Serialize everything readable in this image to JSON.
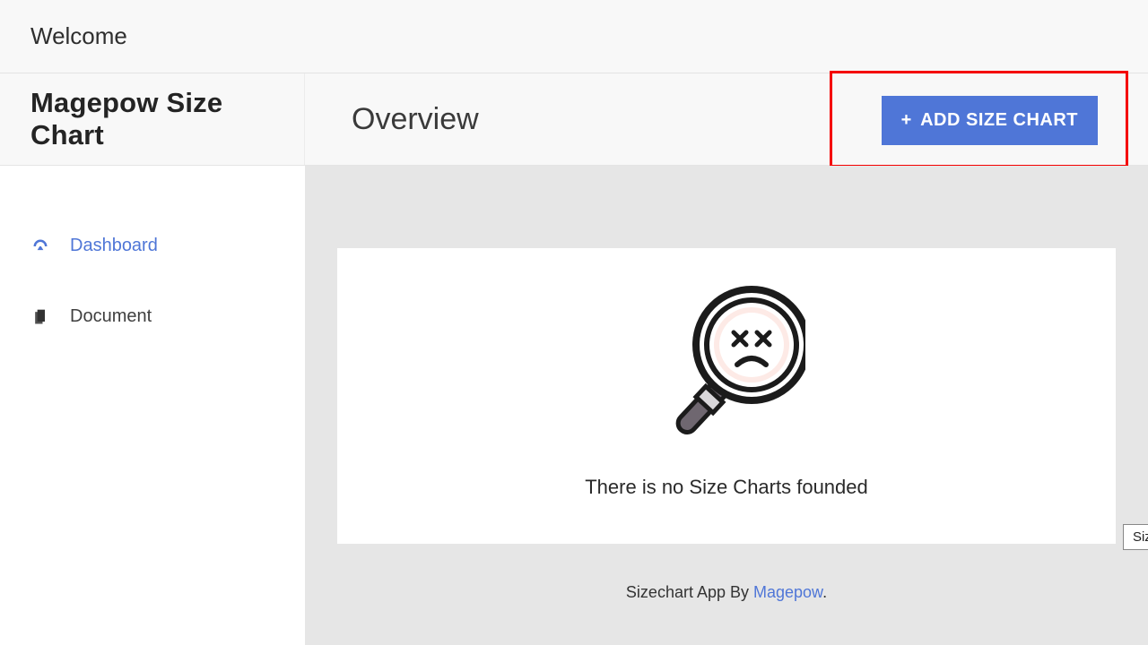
{
  "topbar": {
    "welcome": "Welcome"
  },
  "header": {
    "app_title": "Magepow Size Chart",
    "page_title": "Overview",
    "add_button": {
      "label": "ADD SIZE CHART",
      "prefix": "+"
    }
  },
  "sidebar": {
    "items": [
      {
        "name": "dashboard",
        "label": "Dashboard",
        "icon": "dashboard-icon",
        "active": true
      },
      {
        "name": "document",
        "label": "Document",
        "icon": "document-icon",
        "active": false
      }
    ]
  },
  "main": {
    "empty_state": {
      "message": "There is no Size Charts founded",
      "icon": "magnifier-sad-icon"
    },
    "footer": {
      "prefix": "Sizechart App By ",
      "link_label": "Magepow",
      "suffix": "."
    }
  },
  "tooltip": {
    "text": "Size Chart"
  }
}
